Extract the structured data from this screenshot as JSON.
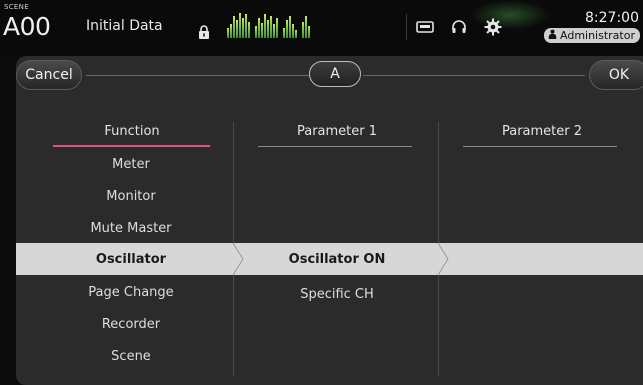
{
  "header": {
    "scene_tag": "SCENE",
    "scene_number": "A00",
    "scene_title": "Initial Data",
    "time": "8:27:00",
    "user": "Administrator",
    "icons": [
      "lock-icon",
      "recorder-icon",
      "headphones-icon",
      "gear-icon",
      "user-icon"
    ]
  },
  "dialog": {
    "cancel_label": "Cancel",
    "ok_label": "OK",
    "key_label": "A"
  },
  "columns": {
    "function_header": "Function",
    "param1_header": "Parameter 1",
    "param2_header": "Parameter 2"
  },
  "function_list": [
    {
      "label": "Meter",
      "selected": false
    },
    {
      "label": "Monitor",
      "selected": false
    },
    {
      "label": "Mute Master",
      "selected": false
    },
    {
      "label": "Oscillator",
      "selected": true
    },
    {
      "label": "Page Change",
      "selected": false
    },
    {
      "label": "Recorder",
      "selected": false
    },
    {
      "label": "Scene",
      "selected": false
    }
  ],
  "param1_list": [
    {
      "label": "Oscillator ON",
      "selected": true
    },
    {
      "label": "Specific CH",
      "selected": false
    }
  ],
  "colors": {
    "accent_underline": "#e0508c",
    "selection": "#d7d7d7",
    "meter_green": "#8fd04a",
    "meter_peak": "#e24a2a"
  }
}
